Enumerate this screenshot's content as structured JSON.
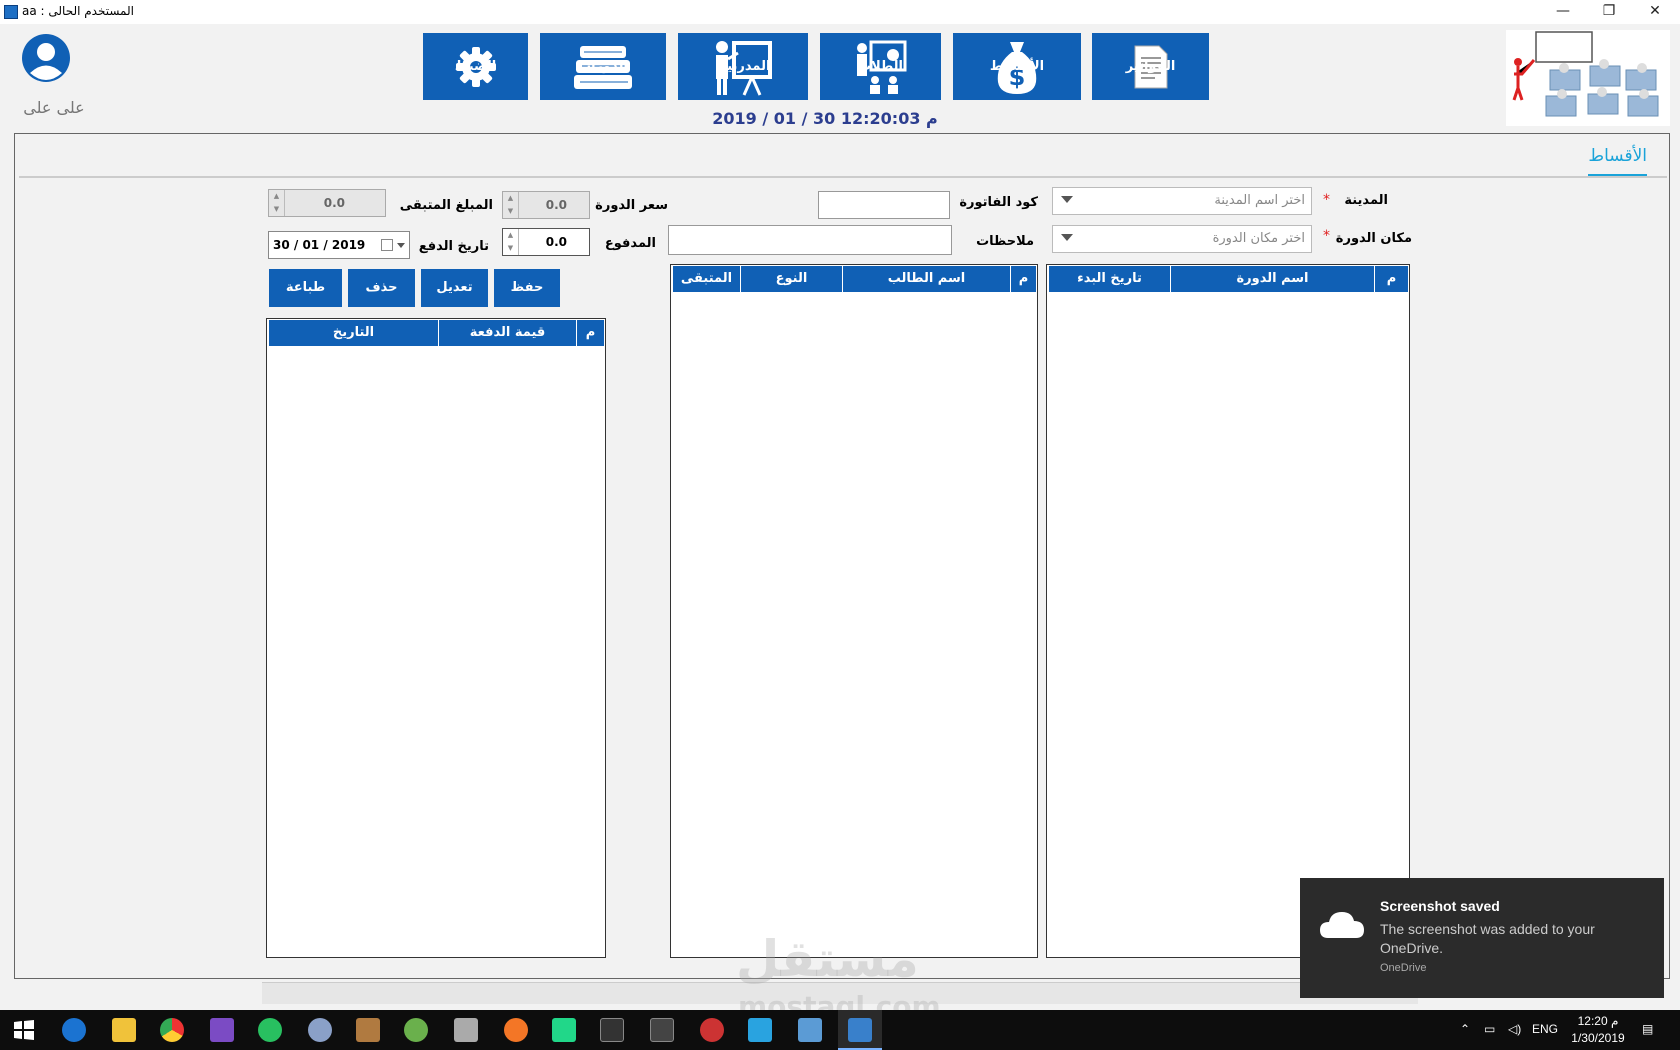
{
  "titlebar": {
    "title": "المستخدم الحالى : aa",
    "minimize": "—",
    "maximize": "❐",
    "close": "✕"
  },
  "user": {
    "name": "على على"
  },
  "nav": {
    "invoices": "الفواتير",
    "installments": "الأقساط",
    "students": "الطلاب",
    "trainers": "المدربين",
    "courses": "الدورات",
    "settings": "الضبط"
  },
  "datetime": "م 12:20:03   30 / 01 / 2019",
  "tab": {
    "label": "الأقساط"
  },
  "form": {
    "city_label": "المدينة",
    "city_placeholder": "اختر اسم المدينة",
    "location_label": "مكان الدورة",
    "location_placeholder": "اختر مكان الدورة",
    "invoice_code_label": "كود الفاتورة",
    "notes_label": "ملاحظات",
    "course_price_label": "سعر الدورة",
    "course_price_value": "0.0",
    "paid_label": "المدفوع",
    "paid_value": "0.0",
    "remaining_label": "المبلغ المتبقى",
    "remaining_value": "0.0",
    "pay_date_label": "تاريخ الدفع",
    "pay_date_value": "30 / 01 / 2019",
    "required_mark": "*"
  },
  "actions": {
    "save": "حفظ",
    "edit": "تعديل",
    "delete": "حذف",
    "print": "طباعة"
  },
  "courses_grid": {
    "columns": [
      "م",
      "اسم الدورة",
      "تاريخ البدء"
    ]
  },
  "students_grid": {
    "columns": [
      "م",
      "اسم الطالب",
      "النوع",
      "المتبقى"
    ]
  },
  "payments_grid": {
    "columns": [
      "م",
      "قيمة الدفعة",
      "التاريخ"
    ]
  },
  "watermark": {
    "line1": "مستقل",
    "line2": "mostaql.com"
  },
  "toast": {
    "title": "Screenshot saved",
    "body": "The screenshot was added to your OneDrive.",
    "source": "OneDrive"
  },
  "taskbar": {
    "language": "ENG",
    "time": "12:20 م",
    "date": "1/30/2019"
  },
  "colors": {
    "accent": "#1060b5",
    "tab": "#1aa3d9",
    "required": "#e02020"
  }
}
